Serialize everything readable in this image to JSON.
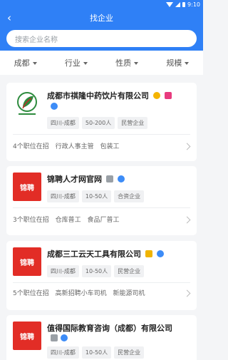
{
  "status": {
    "time": "9:10"
  },
  "header": {
    "title": "找企业"
  },
  "search": {
    "placeholder": "搜索企业名称"
  },
  "filters": [
    {
      "label": "成都"
    },
    {
      "label": "行业"
    },
    {
      "label": "性质"
    },
    {
      "label": "规模"
    }
  ],
  "companies": [
    {
      "name": "成都市祺隆中药饮片有限公司",
      "tags": [
        "四川-成都",
        "50-200人",
        "民营企业"
      ],
      "jobs_summary": "4个职位在招",
      "jobs": [
        "行政人事主管",
        "包装工"
      ]
    },
    {
      "name": "锦聘人才网官网",
      "logo_text": "锦聘",
      "tags": [
        "四川-成都",
        "10-50人",
        "合资企业"
      ],
      "jobs_summary": "3个职位在招",
      "jobs": [
        "仓库普工",
        "食品厂普工"
      ]
    },
    {
      "name": "成都三工云天工具有限公司",
      "logo_text": "锦聘",
      "tags": [
        "四川-成都",
        "10-50人",
        "民营企业"
      ],
      "jobs_summary": "5个职位在招",
      "jobs": [
        "高新招聘小车司机",
        "新能源司机"
      ]
    },
    {
      "name": "值得国际教育咨询（成都）有限公司",
      "logo_text": "锦聘",
      "tags": [
        "四川-成都",
        "10-50人",
        "民营企业"
      ]
    }
  ]
}
